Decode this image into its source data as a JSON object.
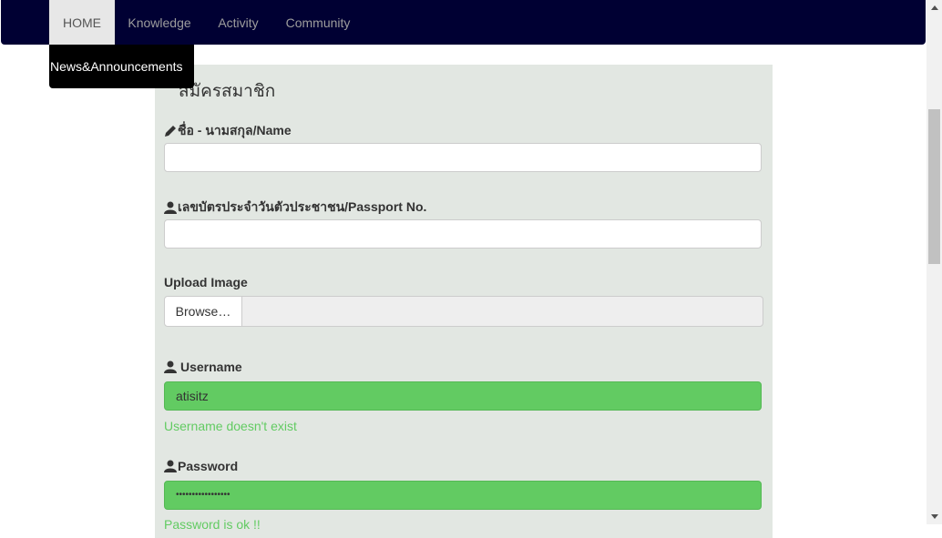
{
  "nav": {
    "items": [
      "HOME",
      "Knowledge",
      "Activity",
      "Community"
    ],
    "dropdown_item": "News&Announcements"
  },
  "form": {
    "title": "สมัครสมาชิก",
    "name_label": "ชื่อ - นามสกุล/Name",
    "id_label": "เลขบัตรประจำวันตัวประชาชน/Passport No.",
    "upload_label": "Upload Image",
    "browse_label": "Browse…",
    "username_label": "Username",
    "username_value": "atisitz",
    "username_help": "Username doesn't exist",
    "password_label": "Password",
    "password_value": "•••••••••••••••••",
    "password_help": "Password is ok !!"
  },
  "icons": {
    "name": "pencil-icon",
    "id": "user-icon",
    "username": "user-icon",
    "password": "user-icon"
  },
  "colors": {
    "navbar": "#000033",
    "panel": "#e2e7e2",
    "success": "#62cb62"
  }
}
